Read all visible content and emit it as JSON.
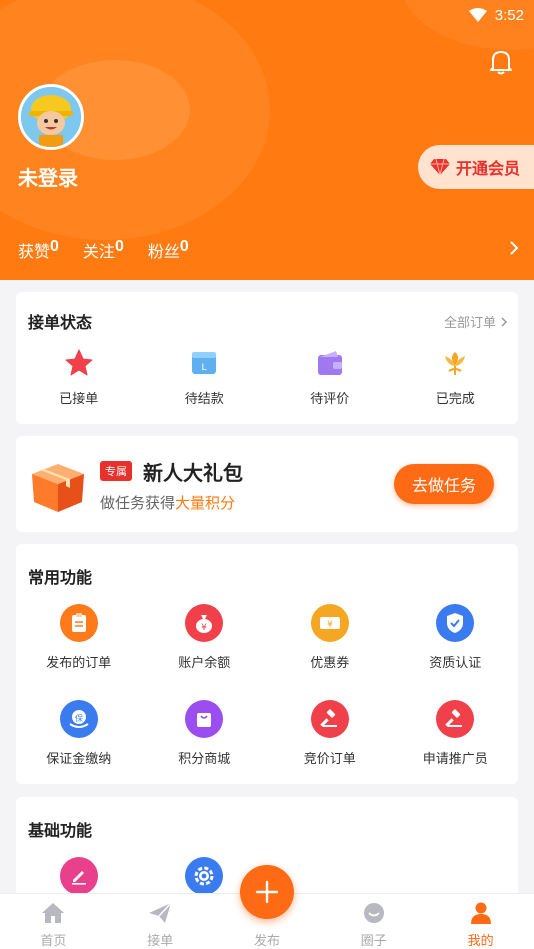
{
  "status_bar": {
    "time": "3:52"
  },
  "profile": {
    "username": "未登录",
    "vip_label": "开通会员",
    "stats": [
      {
        "label": "获赞",
        "value": "0"
      },
      {
        "label": "关注",
        "value": "0"
      },
      {
        "label": "粉丝",
        "value": "0"
      }
    ]
  },
  "orders": {
    "title": "接单状态",
    "all_label": "全部订单",
    "items": [
      {
        "label": "已接单",
        "icon": "star-icon"
      },
      {
        "label": "待结款",
        "icon": "wallet-card-icon"
      },
      {
        "label": "待评价",
        "icon": "purse-icon"
      },
      {
        "label": "已完成",
        "icon": "flower-icon"
      }
    ]
  },
  "promo": {
    "tag": "专属",
    "title": "新人大礼包",
    "subtitle_prefix": "做任务获得",
    "subtitle_highlight": "大量积分",
    "button": "去做任务"
  },
  "common": {
    "title": "常用功能",
    "items": [
      {
        "label": "发布的订单",
        "icon": "clipboard-icon",
        "color": "#ff7a1a"
      },
      {
        "label": "账户余额",
        "icon": "money-bag-icon",
        "color": "#f0404a"
      },
      {
        "label": "优惠券",
        "icon": "coupon-icon",
        "color": "#f5a623"
      },
      {
        "label": "资质认证",
        "icon": "shield-check-icon",
        "color": "#3a7bf0"
      },
      {
        "label": "保证金缴纳",
        "icon": "deposit-icon",
        "color": "#3a7bf0"
      },
      {
        "label": "积分商城",
        "icon": "shop-bag-icon",
        "color": "#9b4df0"
      },
      {
        "label": "竞价订单",
        "icon": "gavel-icon",
        "color": "#f0404a"
      },
      {
        "label": "申请推广员",
        "icon": "gavel-icon",
        "color": "#f0404a"
      }
    ]
  },
  "basic": {
    "title": "基础功能",
    "items": [
      {
        "icon": "edit-icon",
        "color": "#e8408a"
      },
      {
        "icon": "settings-icon",
        "color": "#3a7bf0"
      }
    ]
  },
  "tabbar": {
    "items": [
      {
        "label": "首页",
        "icon": "home-icon"
      },
      {
        "label": "接单",
        "icon": "paper-plane-icon"
      },
      {
        "label": "发布",
        "icon": "plus-icon"
      },
      {
        "label": "圈子",
        "icon": "chat-bubble-icon"
      },
      {
        "label": "我的",
        "icon": "person-icon"
      }
    ],
    "active_index": 4,
    "accent": "#ff6a14"
  }
}
